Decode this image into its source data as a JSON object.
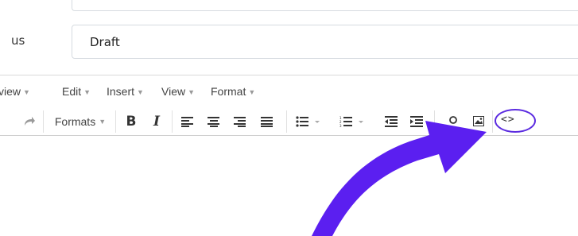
{
  "form": {
    "status_label": "us",
    "status_value": "Draft"
  },
  "menubar": {
    "items": [
      {
        "label": "view"
      },
      {
        "label": "Edit"
      },
      {
        "label": "Insert"
      },
      {
        "label": "View"
      },
      {
        "label": "Format"
      }
    ]
  },
  "toolbar": {
    "formats_label": "Formats",
    "bold_label": "B",
    "italic_label": "I",
    "code_label": "<>",
    "buttons": [
      "redo-icon",
      "formats-dropdown",
      "bold-button",
      "italic-button",
      "align-left-icon",
      "align-center-icon",
      "align-right-icon",
      "align-justify-icon",
      "bullet-list-icon",
      "numbered-list-icon",
      "outdent-icon",
      "indent-icon",
      "link-icon",
      "image-icon",
      "source-code-button"
    ]
  },
  "annotation": {
    "arrow_color": "#5b1ff0",
    "circle_color": "#5b2be0"
  }
}
